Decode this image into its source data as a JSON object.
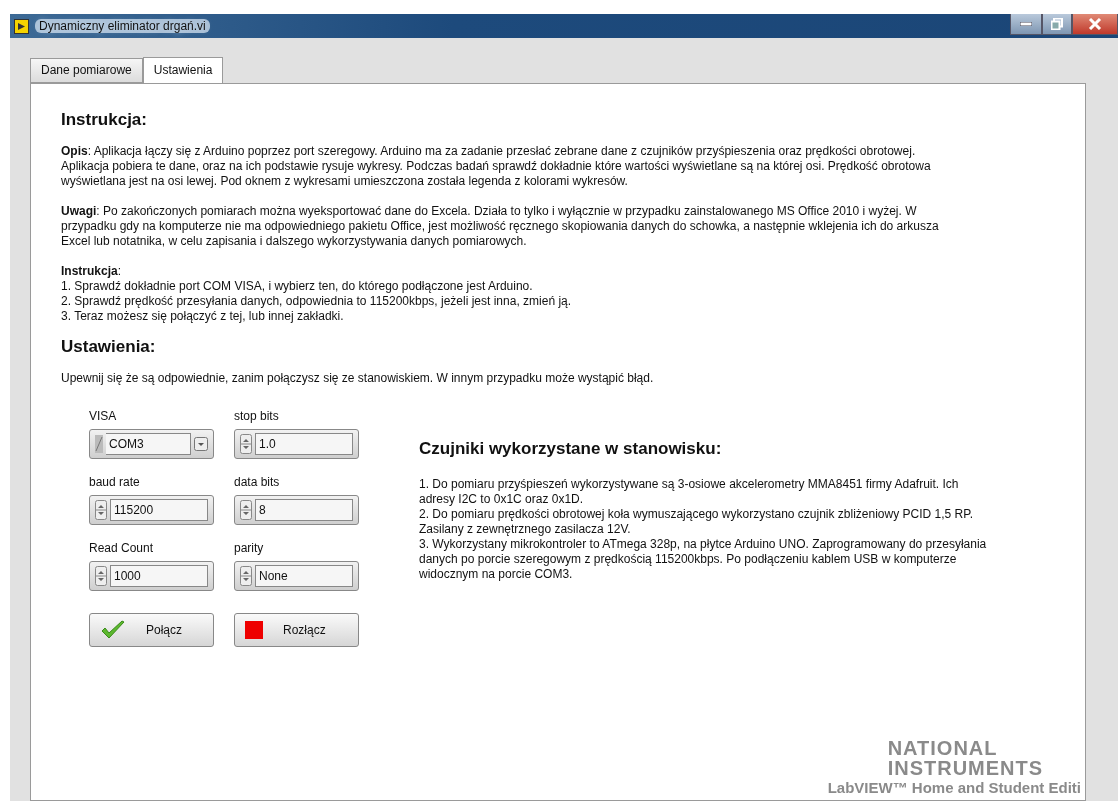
{
  "window": {
    "title": "Dynamiczny eliminator drgań.vi"
  },
  "tabs": [
    {
      "label": "Dane pomiarowe",
      "selected": false
    },
    {
      "label": "Ustawienia",
      "selected": true
    }
  ],
  "instructions": {
    "heading": "Instrukcja:",
    "paragraphs": [
      {
        "lines": [
          "**Opis**: Aplikacja łączy się z Arduino poprzez port szeregowy. Arduino ma za zadanie przesłać zebrane dane z czujników przyśpieszenia oraz prędkości obrotowej.",
          "Aplikacja pobiera te dane, oraz na ich podstawie rysuje wykresy. Podczas badań sprawdź dokładnie które wartości wyświetlane są na której osi. Prędkość obrotowa",
          "wyświetlana jest na osi lewej. Pod oknem z wykresami umieszczona została legenda z kolorami wykresów."
        ]
      },
      {
        "lines": [
          "**Uwagi**: Po zakończonych pomiarach można wyeksportować dane do Excela. Działa to tylko i wyłącznie w przypadku zainstalowanego MS Office 2010 i wyżej. W",
          "przypadku gdy na komputerze nie ma odpowiedniego pakietu Office, jest możliwość ręcznego skopiowania danych do schowka, a następnie wklejenia ich do arkusza",
          "Excel lub notatnika, w celu zapisania i dalszego wykorzystywania danych pomiarowych."
        ]
      },
      {
        "lines": [
          "**Instrukcja**:",
          "1. Sprawdź dokładnie port COM VISA, i wybierz ten, do którego podłączone jest Arduino.",
          "2. Sprawdź prędkość przesyłania danych, odpowiednia to 115200kbps, jeżeli jest inna, zmień ją.",
          "3. Teraz możesz się połączyć z tej, lub innej zakładki."
        ]
      }
    ]
  },
  "settings": {
    "heading": "Ustawienia:",
    "note": "Upewnij się że są odpowiednie, zanim połączysz się ze stanowiskiem. W innym przypadku może wystąpić błąd.",
    "controls": [
      {
        "label": "VISA",
        "value": "COM3",
        "kind": "visa"
      },
      {
        "label": "baud rate",
        "value": "115200",
        "kind": "numeric"
      },
      {
        "label": "Read Count",
        "value": "1000",
        "kind": "numeric"
      },
      {
        "label": "stop bits",
        "value": "1.0",
        "kind": "numeric"
      },
      {
        "label": "data bits",
        "value": "8",
        "kind": "numeric"
      },
      {
        "label": "parity",
        "value": "None",
        "kind": "numeric"
      }
    ],
    "buttons": [
      {
        "label": "Połącz",
        "kind": "connect"
      },
      {
        "label": "Rozłącz",
        "kind": "disconnect"
      }
    ]
  },
  "sensors": {
    "heading": "Czujniki wykorzystane w stanowisku:",
    "lines": [
      "1. Do pomiaru przyśpieszeń wykorzystywane są 3-osiowe akcelerometry MMA8451 firmy Adafruit. Ich",
      "adresy I2C to 0x1C oraz 0x1D.",
      "2. Do pomiaru prędkości obrotowej koła wymuszającego wykorzystano czujnik zbliżeniowy PCID 1,5 RP.",
      "Zasilany z zewnętrznego zasilacza 12V.",
      "3. Wykorzystany mikrokontroler to ATmega 328p, na płytce Arduino UNO. Zaprogramowany do przesyłania",
      "danych po porcie szeregowym z prędkością 115200kbps. Po podłączeniu kablem USB w komputerze",
      "widocznym na porcie COM3."
    ]
  },
  "watermark": {
    "lines": [
      "NATIONAL",
      "INSTRUMENTS",
      "LabVIEW™ Home and Student Editi"
    ]
  }
}
